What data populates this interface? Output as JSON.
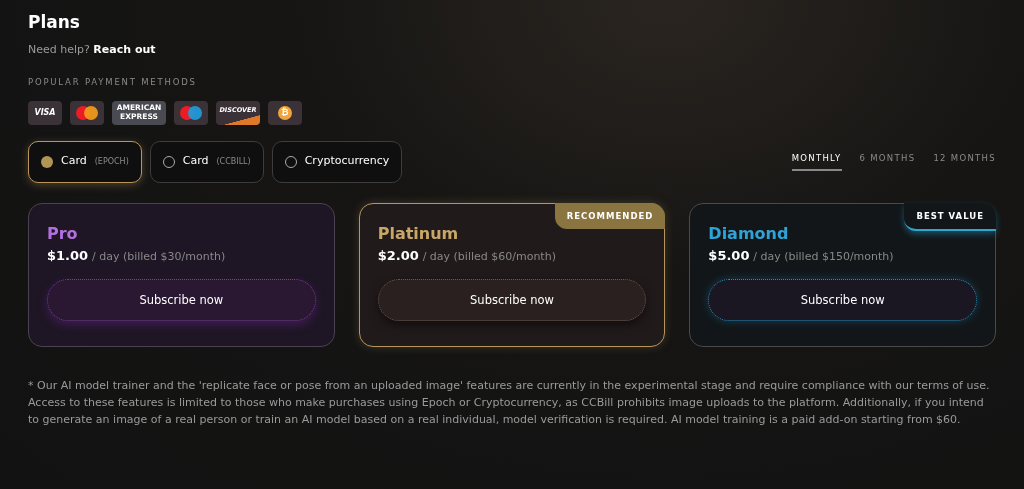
{
  "title": "Plans",
  "help": {
    "text": "Need help?",
    "link": "Reach out"
  },
  "payment_heading": "POPULAR PAYMENT METHODS",
  "payment_methods": [
    {
      "kind": "visa",
      "label": "VISA"
    },
    {
      "kind": "mastercard"
    },
    {
      "kind": "amex",
      "label": "AMERICAN EXPRESS"
    },
    {
      "kind": "maestro"
    },
    {
      "kind": "discover",
      "label": "DISCOVER"
    },
    {
      "kind": "bitcoin",
      "label": "₿"
    }
  ],
  "payment_options": [
    {
      "label": "Card",
      "note": "(EPOCH)",
      "selected": true
    },
    {
      "label": "Card",
      "note": "(CCBILL)",
      "selected": false
    },
    {
      "label": "Cryptocurrency",
      "selected": false
    }
  ],
  "periods": [
    {
      "label": "MONTHLY",
      "selected": true
    },
    {
      "label": "6 MONTHS",
      "selected": false
    },
    {
      "label": "12 MONTHS",
      "selected": false
    }
  ],
  "plans": [
    {
      "kind": "pro",
      "name": "Pro",
      "color": "#b36fe0",
      "price": "$1.00",
      "unit": "/ day",
      "billed": "(billed $30/month)",
      "button": "Subscribe now"
    },
    {
      "kind": "platinum",
      "name": "Platinum",
      "color": "#c9a766",
      "price": "$2.00",
      "unit": "/ day",
      "billed": "(billed $60/month)",
      "button": "Subscribe now",
      "badge": "RECOMMENDED"
    },
    {
      "kind": "diamond",
      "name": "Diamond",
      "color": "#2fa3d6",
      "price": "$5.00",
      "unit": "/ day",
      "billed": "(billed $150/month)",
      "button": "Subscribe now",
      "badge": "BEST VALUE"
    }
  ],
  "footnote": "* Our AI model trainer and the 'replicate face or pose from an uploaded image' features are currently in the experimental stage and require compliance with our terms of use. Access to these features is limited to those who make purchases using Epoch or Cryptocurrency, as CCBill prohibits image uploads to the platform. Additionally, if you intend to generate an image of a real person or train an AI model based on a real individual, model verification is required. AI model training is a paid add-on starting from $60."
}
